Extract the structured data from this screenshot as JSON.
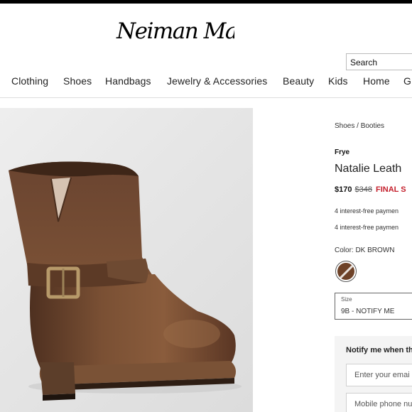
{
  "header": {
    "brand_logo": "Neiman Marcus",
    "search_placeholder": "Search"
  },
  "nav": {
    "items": [
      {
        "label": "Clothing"
      },
      {
        "label": "Shoes"
      },
      {
        "label": "Handbags"
      },
      {
        "label": "Jewelry & Accessories"
      },
      {
        "label": "Beauty"
      },
      {
        "label": "Kids"
      },
      {
        "label": "Home"
      },
      {
        "label": "G"
      }
    ]
  },
  "product": {
    "breadcrumb": "Shoes / Booties",
    "brand": "Frye",
    "name": "Natalie Leath",
    "price": "$170",
    "original_price": "$348",
    "sale_label": "FINAL S",
    "payment_lines": [
      "4 interest-free paymen",
      "4 interest-free paymen"
    ],
    "color_label": "Color: DK BROWN",
    "swatch_color": "#6e4228",
    "size": {
      "label": "Size",
      "value": "9B - NOTIFY ME"
    }
  },
  "notify": {
    "title": "Notify me when th",
    "email_placeholder": "Enter your emai",
    "phone_placeholder": "Mobile phone nu"
  },
  "colors": {
    "sale_red": "#c41e2b",
    "boot_brown": "#6e4228"
  }
}
